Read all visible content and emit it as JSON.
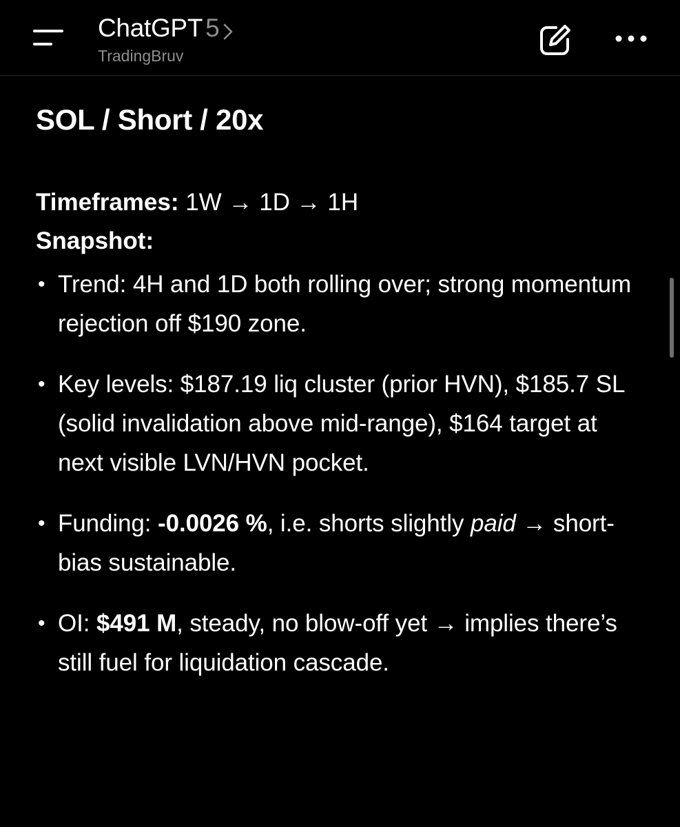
{
  "header": {
    "title": "ChatGPT",
    "version": "5",
    "subtitle": "TradingBruv",
    "menu_icon": "hamburger-menu-icon",
    "edit_icon": "edit-icon",
    "more_icon": "more-icon"
  },
  "message": {
    "heading": "SOL / Short / 20x",
    "timeframes_label": "Timeframes:",
    "timeframes_value": " 1W → 1D → 1H",
    "snapshot_label": "Snapshot:",
    "bullets": [
      {
        "text": "Trend: 4H and 1D both rolling over; strong momentum rejection off $190 zone."
      },
      {
        "text": "Key levels: $187.19 liq cluster (prior HVN), $185.7 SL (solid invalidation above mid-range), $164 target at next visible LVN/HVN pocket."
      },
      {
        "prefix": "Funding: ",
        "bold": "-0.0026 %",
        "middle": ", i.e. shorts slightly ",
        "italic": "paid",
        "suffix": " → short-bias sustainable."
      },
      {
        "prefix": "OI: ",
        "bold": "$491 M",
        "suffix": ", steady, no blow-off yet → implies there’s still fuel for liquidation cascade."
      }
    ]
  },
  "colors": {
    "background": "#000000",
    "text": "#ffffff",
    "muted": "#8e8e8e",
    "divider": "#262626",
    "scrollbar": "#6e6e6e"
  },
  "bullet_glyph": "•"
}
